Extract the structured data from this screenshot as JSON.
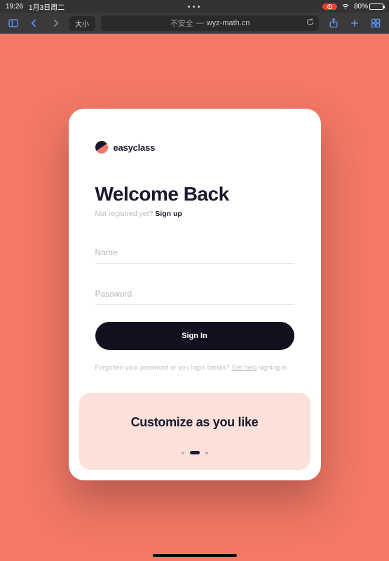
{
  "status": {
    "time": "19:26",
    "date": "1月3日周二",
    "battery_percent": "80%"
  },
  "toolbar": {
    "size_label": "大小",
    "insecure_label": "不安全",
    "separator": "—",
    "url": "wyz-math.cn"
  },
  "logo": {
    "text": "easyclass"
  },
  "headline": "Welcome Back",
  "subline": {
    "prefix": "Not registred yet? ",
    "link": "Sign up"
  },
  "fields": {
    "name_placeholder": "Name",
    "password_placeholder": "Password"
  },
  "signin_label": "Sign In",
  "helper": {
    "prefix": "Forgotten your password or you login datails? ",
    "link": "Get help",
    "suffix": " signing in"
  },
  "promo": {
    "title": "Customize as you like"
  }
}
